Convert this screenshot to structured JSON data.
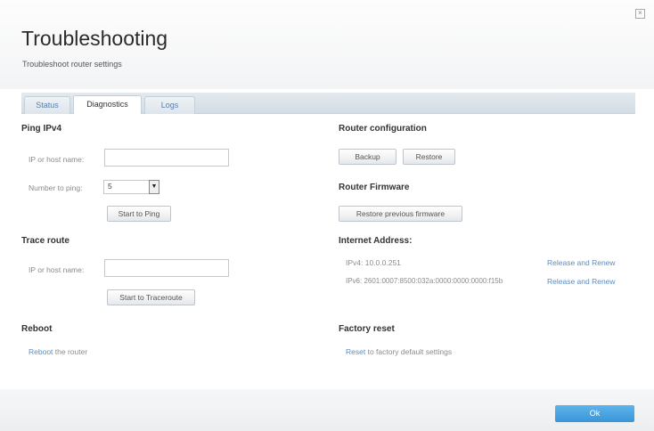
{
  "page": {
    "title": "Troubleshooting",
    "subtitle": "Troubleshoot router settings"
  },
  "tabs": [
    {
      "label": "Status",
      "active": false
    },
    {
      "label": "Diagnostics",
      "active": true
    },
    {
      "label": "Logs",
      "active": false
    }
  ],
  "ping": {
    "title": "Ping IPv4",
    "host_label": "IP or host name:",
    "host_value": "",
    "number_label": "Number to ping:",
    "number_value": "5",
    "start_button": "Start to Ping"
  },
  "trace": {
    "title": "Trace route",
    "host_label": "IP or host name:",
    "host_value": "",
    "start_button": "Start to Traceroute"
  },
  "reboot": {
    "title": "Reboot",
    "link_text": "Reboot",
    "rest_text": " the router"
  },
  "router_config": {
    "title": "Router configuration",
    "backup_button": "Backup",
    "restore_button": "Restore"
  },
  "firmware": {
    "title": "Router Firmware",
    "restore_button": "Restore previous firmware"
  },
  "internet_address": {
    "title": "Internet Address:",
    "ipv4_text": "IPv4: 10.0.0.251",
    "ipv6_text": "IPv6: 2601:0007:8500:032a:0000:0000:0000:f15b",
    "renew_label_1": "Release and Renew",
    "renew_label_2": "Release and Renew"
  },
  "factory": {
    "title": "Factory reset",
    "link_text": "Reset",
    "rest_text": " to factory default settings"
  },
  "footer": {
    "ok_label": "Ok"
  },
  "icons": {
    "close": "close-icon",
    "dropdown": "chevron-down-icon"
  },
  "colors": {
    "link": "#5a8cc4",
    "ok_button": "#3896d8"
  }
}
